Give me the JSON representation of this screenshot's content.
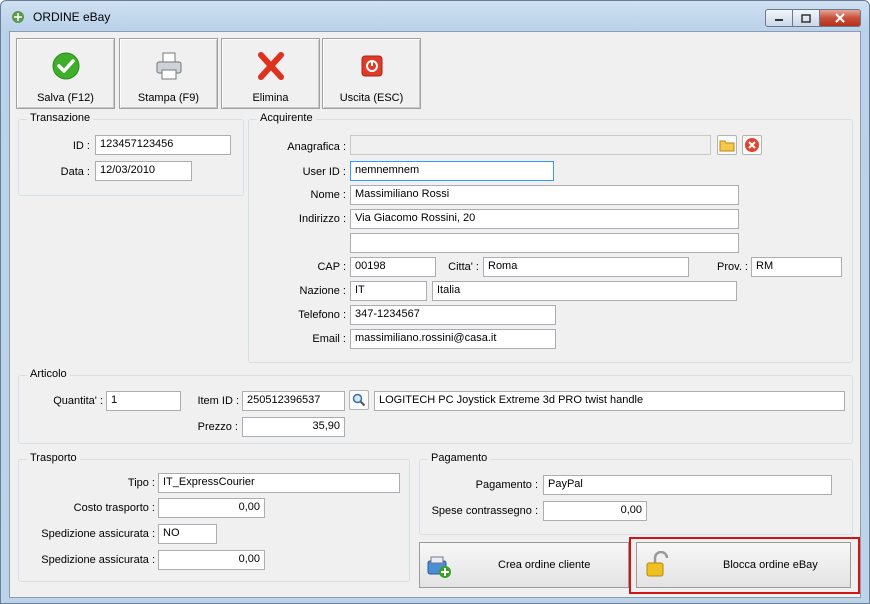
{
  "window": {
    "title": "ORDINE eBay"
  },
  "toolbar": {
    "save_label": "Salva (F12)",
    "print_label": "Stampa (F9)",
    "delete_label": "Elimina",
    "exit_label": "Uscita (ESC)"
  },
  "transazione": {
    "title": "Transazione",
    "id_label": "ID :",
    "id_value": "123457123456",
    "data_label": "Data :",
    "data_value": "12/03/2010"
  },
  "acquirente": {
    "title": "Acquirente",
    "anagrafica_label": "Anagrafica :",
    "anagrafica_value": "",
    "userid_label": "User ID :",
    "userid_value": "nemnemnem",
    "nome_label": "Nome :",
    "nome_value": "Massimiliano Rossi",
    "indirizzo_label": "Indirizzo :",
    "indirizzo_value": "Via Giacomo Rossini, 20",
    "indirizzo2_value": "",
    "cap_label": "CAP :",
    "cap_value": "00198",
    "citta_label": "Citta' :",
    "citta_value": "Roma",
    "prov_label": "Prov. :",
    "prov_value": "RM",
    "nazione_label": "Nazione :",
    "nazione_code": "IT",
    "nazione_name": "Italia",
    "telefono_label": "Telefono :",
    "telefono_value": "347-1234567",
    "email_label": "Email :",
    "email_value": "massimiliano.rossini@casa.it"
  },
  "articolo": {
    "title": "Articolo",
    "quantita_label": "Quantita' :",
    "quantita_value": "1",
    "itemid_label": "Item ID :",
    "itemid_value": "250512396537",
    "descrizione_value": "LOGITECH PC Joystick Extreme 3d PRO twist handle",
    "prezzo_label": "Prezzo :",
    "prezzo_value": "35,90"
  },
  "trasporto": {
    "title": "Trasporto",
    "tipo_label": "Tipo :",
    "tipo_value": "IT_ExpressCourier",
    "costo_label": "Costo trasporto :",
    "costo_value": "0,00",
    "assicurata_label": "Spedizione assicurata :",
    "assicurata_value": "NO",
    "assicurata2_label": "Spedizione assicurata :",
    "assicurata2_value": "0,00"
  },
  "pagamento": {
    "title": "Pagamento",
    "pagamento_label": "Pagamento :",
    "pagamento_value": "PayPal",
    "spese_label": "Spese contrassegno :",
    "spese_value": "0,00"
  },
  "actions": {
    "crea_label": "Crea ordine cliente",
    "blocca_label": "Blocca ordine eBay"
  },
  "colors": {
    "highlight": "#d11414",
    "window_frame": "#bcd3ea",
    "client_bg": "#f0f0f0"
  }
}
